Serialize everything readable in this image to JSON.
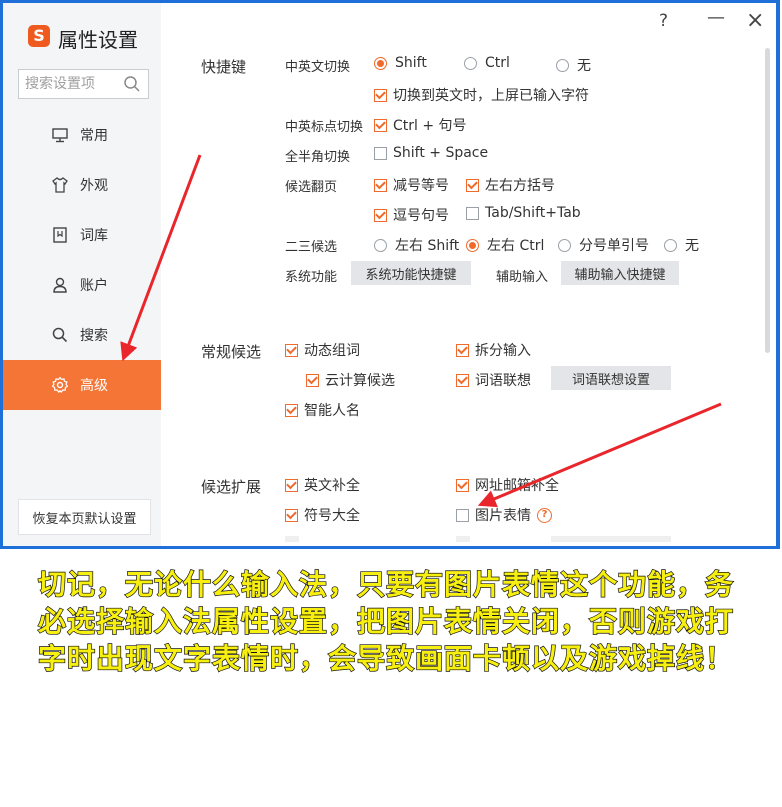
{
  "window": {
    "title": "属性设置",
    "logo_glyph": "S",
    "help_label": "?",
    "minimize_label": "—",
    "close_label": "×"
  },
  "sidebar": {
    "search_placeholder": "搜索设置项",
    "items": [
      {
        "label": "常用",
        "icon": "monitor-icon"
      },
      {
        "label": "外观",
        "icon": "shirt-icon"
      },
      {
        "label": "词库",
        "icon": "book-icon"
      },
      {
        "label": "账户",
        "icon": "user-icon"
      },
      {
        "label": "搜索",
        "icon": "search-icon"
      },
      {
        "label": "高级",
        "icon": "gear-icon",
        "active": true
      }
    ],
    "reset_label": "恢复本页默认设置"
  },
  "shortcut": {
    "title": "快捷键",
    "cn_en_switch": {
      "label": "中英文切换",
      "options": [
        "Shift",
        "Ctrl",
        "无"
      ],
      "selected": "Shift"
    },
    "switch_commit": {
      "label": "切换到英文时，上屏已输入字符",
      "checked": true
    },
    "punct_switch": {
      "label": "中英标点切换",
      "option": "Ctrl + 句号",
      "checked": true
    },
    "fullwidth_switch": {
      "label": "全半角切换",
      "option": "Shift + Space",
      "checked": false
    },
    "page_turn": {
      "label": "候选翻页",
      "options": [
        {
          "label": "减号等号",
          "checked": true
        },
        {
          "label": "左右方括号",
          "checked": true
        },
        {
          "label": "逗号句号",
          "checked": true
        },
        {
          "label": "Tab/Shift+Tab",
          "checked": false
        }
      ]
    },
    "candidate_23": {
      "label": "二三候选",
      "options": [
        "左右 Shift",
        "左右 Ctrl",
        "分号单引号",
        "无"
      ],
      "selected": "左右 Ctrl"
    },
    "system_func": {
      "label": "系统功能",
      "button": "系统功能快捷键"
    },
    "aux_input": {
      "label": "辅助输入",
      "button": "辅助输入快捷键"
    }
  },
  "general": {
    "title": "常规候选",
    "dynamic_phrase": {
      "label": "动态组词",
      "checked": true
    },
    "split_input": {
      "label": "拆分输入",
      "checked": true
    },
    "cloud_candidate": {
      "label": "云计算候选",
      "checked": true
    },
    "word_assoc": {
      "label": "词语联想",
      "checked": true
    },
    "word_assoc_button": "词语联想设置",
    "smart_name": {
      "label": "智能人名",
      "checked": true
    }
  },
  "extension": {
    "title": "候选扩展",
    "english_complete": {
      "label": "英文补全",
      "checked": true
    },
    "url_email": {
      "label": "网址邮箱补全",
      "checked": true
    },
    "symbols": {
      "label": "符号大全",
      "checked": true
    },
    "picture_emoji": {
      "label": "图片表情",
      "checked": false
    }
  },
  "caption": "切记，无论什么输入法，只要有图片表情这个功能，务必选择输入法属性设置，把图片表情关闭，否则游戏打字时出现文字表情时，会导致画面卡顿以及游戏掉线！",
  "colors": {
    "accent": "#f47535",
    "frame": "#1e6fd8",
    "arrow": "#e8262b",
    "caption": "#f7ef10"
  }
}
